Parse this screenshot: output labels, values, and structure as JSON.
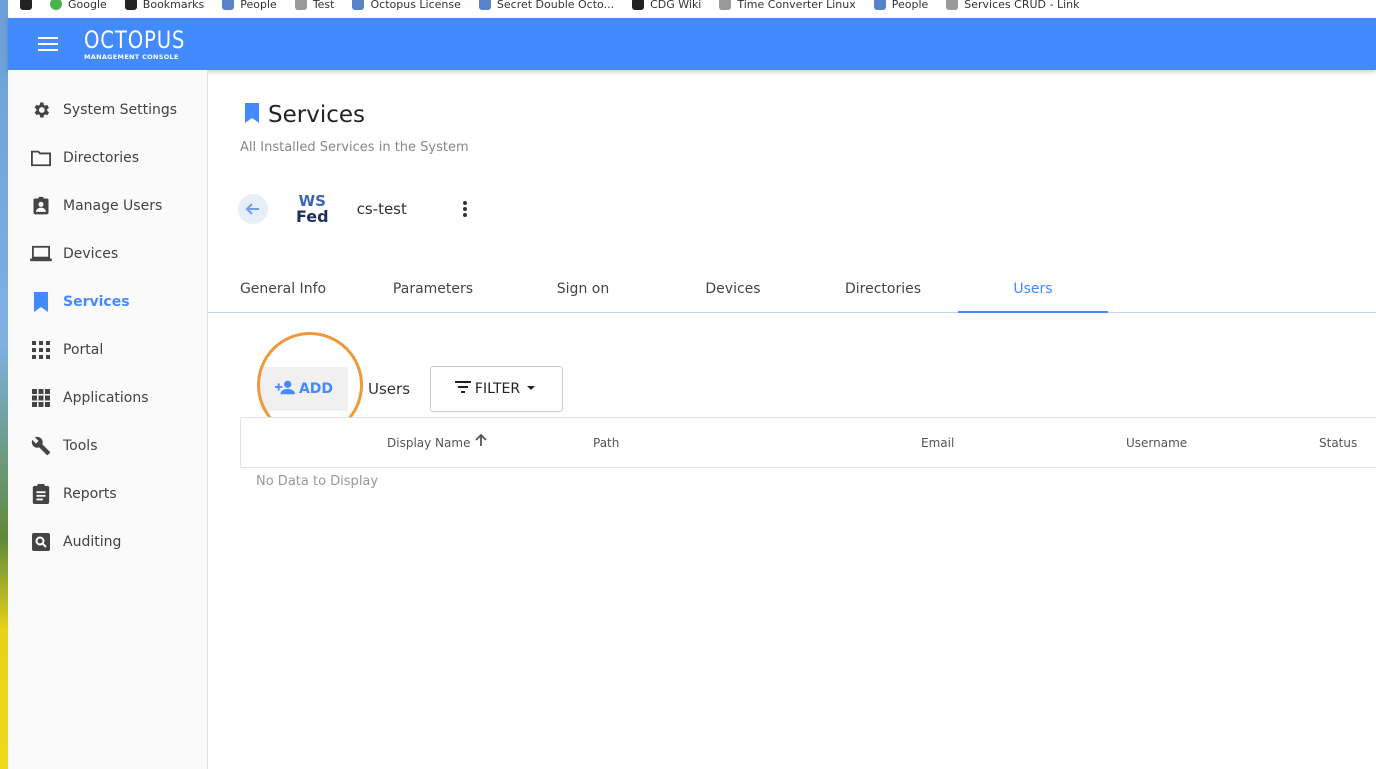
{
  "bookmarks": [
    "Google",
    "Bookmarks",
    "People",
    "Test",
    "Octopus License",
    "Secret Double Octo...",
    "CDG Wiki",
    "Time Converter Linux",
    "People",
    "Services CRUD - Link"
  ],
  "header": {
    "logo_main": "OCTOPUS",
    "logo_sub": "MANAGEMENT CONSOLE",
    "brand_color": "#448aff"
  },
  "sidebar": {
    "items": [
      {
        "label": "System Settings",
        "icon": "gear-icon",
        "active": false
      },
      {
        "label": "Directories",
        "icon": "folder-icon",
        "active": false
      },
      {
        "label": "Manage Users",
        "icon": "user-badge-icon",
        "active": false
      },
      {
        "label": "Devices",
        "icon": "laptop-icon",
        "active": false
      },
      {
        "label": "Services",
        "icon": "bookmark-icon",
        "active": true
      },
      {
        "label": "Portal",
        "icon": "grid-icon",
        "active": false
      },
      {
        "label": "Applications",
        "icon": "apps-icon",
        "active": false
      },
      {
        "label": "Tools",
        "icon": "wrench-icon",
        "active": false
      },
      {
        "label": "Reports",
        "icon": "clipboard-icon",
        "active": false
      },
      {
        "label": "Auditing",
        "icon": "search-box-icon",
        "active": false
      }
    ]
  },
  "page": {
    "title": "Services",
    "subtitle": "All Installed Services in the System"
  },
  "service": {
    "logo_line1": "WS",
    "logo_line2": "Fed",
    "name": "cs-test"
  },
  "tabs": [
    {
      "label": "General Info",
      "active": false
    },
    {
      "label": "Parameters",
      "active": false
    },
    {
      "label": "Sign on",
      "active": false
    },
    {
      "label": "Devices",
      "active": false
    },
    {
      "label": "Directories",
      "active": false
    },
    {
      "label": "Users",
      "active": true
    }
  ],
  "toolbar": {
    "add_label": "ADD",
    "section_label": "Users",
    "filter_label": "FILTER"
  },
  "table": {
    "columns": [
      "Display Name",
      "Path",
      "Email",
      "Username",
      "Status"
    ],
    "sort_column": "Display Name",
    "sort_direction": "ascending",
    "empty_message": "No Data to Display"
  }
}
